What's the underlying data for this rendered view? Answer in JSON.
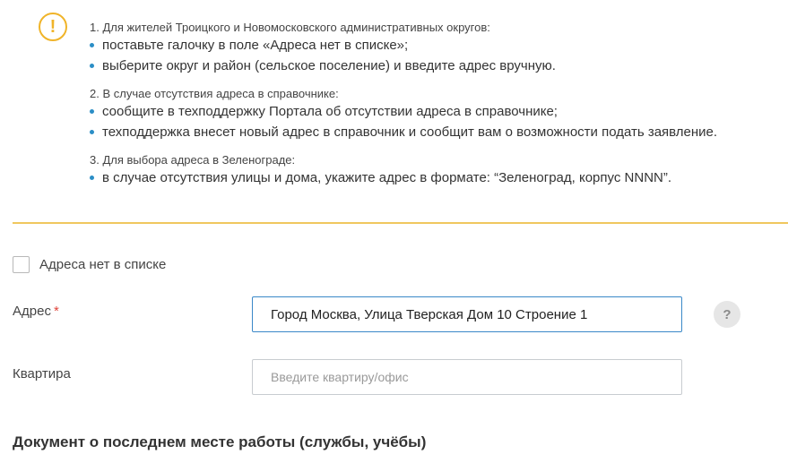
{
  "notice": {
    "icon": "exclamation-icon",
    "accent_color": "#f0b429",
    "bullet_color": "#2b8ec6",
    "blocks": [
      {
        "title": "1. Для жителей Троицкого и Новомосковского административных округов:",
        "items": [
          "поставьте галочку в поле «Адреса нет в списке»;",
          "выберите округ и район (сельское поселение) и введите адрес вручную."
        ]
      },
      {
        "title": "2. В случае отсутствия адреса в справочнике:",
        "items": [
          "сообщите в техподдержку Портала об отсутствии адреса в справочнике;",
          "техподдержка внесет новый адрес в справочник и сообщит вам о возможности подать заявление."
        ]
      },
      {
        "title": "3. Для выбора адреса в Зеленограде:",
        "items": [
          "в случае отсутствия улицы и дома, укажите адрес в формате: “Зеленоград, корпус NNNN”."
        ]
      }
    ]
  },
  "form": {
    "no_address_checkbox": {
      "label": "Адреса нет в списке",
      "checked": false
    },
    "address": {
      "label": "Адрес",
      "required_mark": "*",
      "value": "Город Москва, Улица Тверская Дом 10 Строение 1"
    },
    "help": {
      "icon": "question-icon",
      "glyph": "?"
    },
    "apartment": {
      "label": "Квартира",
      "value": "",
      "placeholder": "Введите квартиру/офис"
    }
  },
  "section": {
    "title": "Документ о последнем месте работы (службы, учёбы)"
  }
}
